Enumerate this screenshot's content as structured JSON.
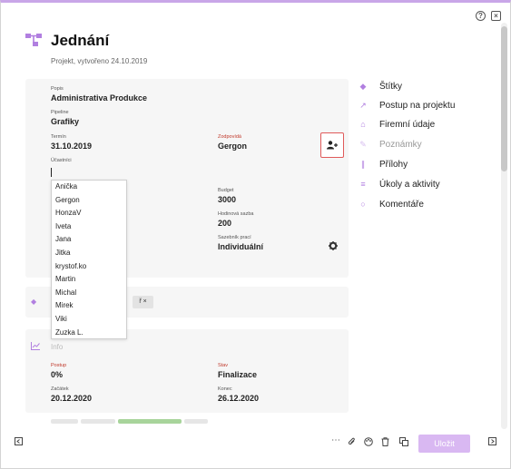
{
  "window": {
    "help_icon": "question-circle-icon",
    "close_icon": "close-box-icon"
  },
  "header": {
    "title": "Jednání",
    "subtitle": "Projekt, vytvořeno 24.10.2019"
  },
  "details": {
    "popis_label": "Popis",
    "popis_value": "Administrativa Produkce",
    "pipeline_label": "Pipeline",
    "pipeline_value": "Grafiky",
    "termin_label": "Termín",
    "termin_value": "31.10.2019",
    "zodpovida_label": "Zodpovídá",
    "zodpovida_value": "Gergon",
    "ucastnici_label": "Účastníci",
    "budget_label": "Budget",
    "budget_value": "3000",
    "hodinova_label": "Hodinová sazba",
    "hodinova_value": "200",
    "sazebnik_label": "Sazebník prací",
    "sazebnik_value": "Individuální"
  },
  "participants_dropdown": [
    "Anička",
    "Gergon",
    "HonzaV",
    "Iveta",
    "Jana",
    "Jitka",
    "krystof.ko",
    "Martin",
    "Michal",
    "Mirek",
    "Viki",
    "Zuzka L."
  ],
  "tags": {
    "chip_label": "ř ×"
  },
  "info": {
    "title": "Info",
    "postup_label": "Postup",
    "postup_value": "0%",
    "stav_label": "Stav",
    "stav_value": "Finalizace",
    "zacatek_label": "Začátek",
    "zacatek_value": "20.12.2020",
    "konec_label": "Konec",
    "konec_value": "26.12.2020"
  },
  "sidebar": {
    "items": [
      {
        "label": "Štítky",
        "icon": "tag-icon",
        "disabled": false
      },
      {
        "label": "Postup na projektu",
        "icon": "chart-line-icon",
        "disabled": false
      },
      {
        "label": "Firemní údaje",
        "icon": "home-icon",
        "disabled": false
      },
      {
        "label": "Poznámky",
        "icon": "edit-icon",
        "disabled": true
      },
      {
        "label": "Přílohy",
        "icon": "paperclip-icon",
        "disabled": false
      },
      {
        "label": "Úkoly a aktivity",
        "icon": "list-icon",
        "disabled": false
      },
      {
        "label": "Komentáře",
        "icon": "comment-icon",
        "disabled": false
      }
    ]
  },
  "footer": {
    "save_label": "Uložit"
  },
  "colors": {
    "accent": "#b17fe0",
    "save_button": "#d9b8f2",
    "required_label": "#c0392b",
    "highlight_border": "#e05a5a"
  }
}
